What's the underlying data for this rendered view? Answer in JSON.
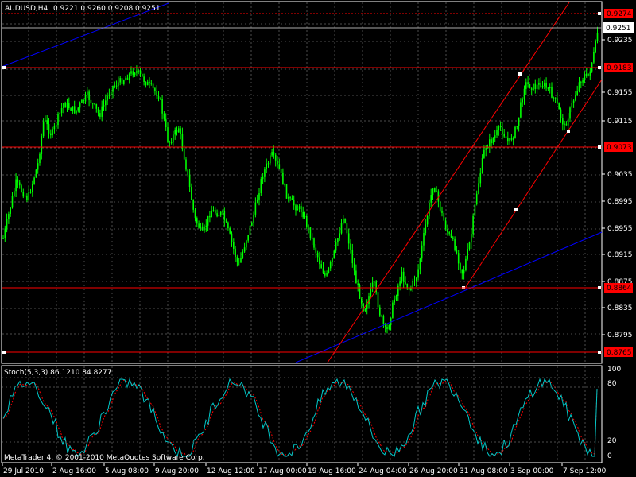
{
  "main_chart": {
    "symbol_label": "AUDUSD,H4",
    "ohlc_label": "0.9221 0.9260 0.9208 0.9251",
    "current_price": "0.9251",
    "price_ticks": [
      "0.9235",
      "0.9155",
      "0.9115",
      "0.9035",
      "0.8995",
      "0.8955",
      "0.8915",
      "0.8875",
      "0.8835",
      "0.8795"
    ],
    "horizontal_levels": [
      "0.9274",
      "0.9183",
      "0.9073",
      "0.8864",
      "0.8765"
    ],
    "colors": {
      "background": "#000000",
      "grid": "#4d4d4d",
      "candles": "#00ff00",
      "levels": "#ff0000",
      "trendline": "#0000ff",
      "channel": "#ff0000"
    }
  },
  "stochastic": {
    "label": "Stoch(5,3,3) 86.1210 84.8277",
    "k_value": 86.121,
    "d_value": 84.8277,
    "scale_ticks": [
      "100",
      "80",
      "20",
      "0"
    ],
    "colors": {
      "main": "#00c8c8",
      "signal": "#ff0000"
    }
  },
  "copyright": "MetaTrader 4, © 2001-2010 MetaQuotes Software Corp.",
  "time_axis": [
    "29 Jul 2010",
    "2 Aug 16:00",
    "5 Aug 08:00",
    "9 Aug 20:00",
    "12 Aug 12:00",
    "17 Aug 00:00",
    "19 Aug 16:00",
    "24 Aug 04:00",
    "26 Aug 20:00",
    "31 Aug 08:00",
    "3 Sep 00:00",
    "7 Sep 12:00"
  ]
}
